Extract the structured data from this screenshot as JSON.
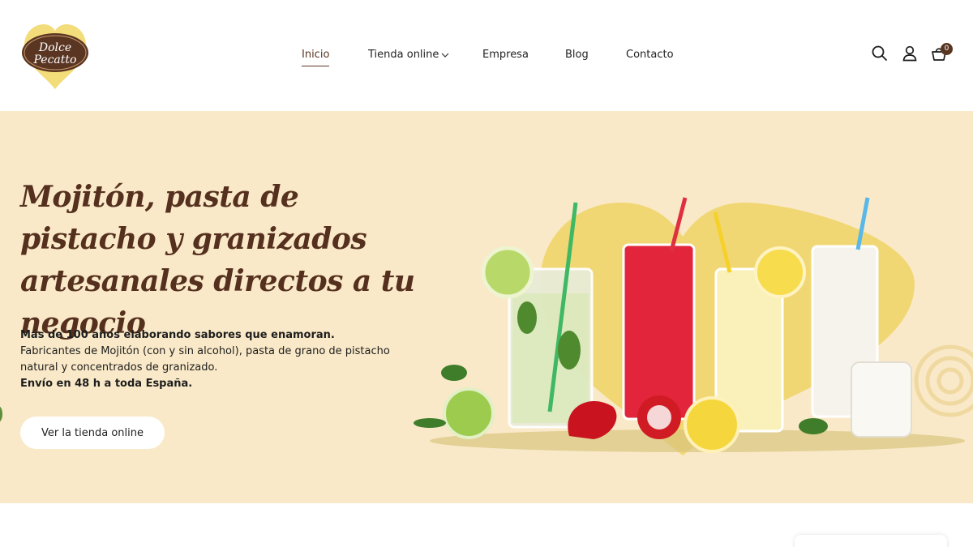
{
  "header": {
    "logo_alt": "Dolce Pecatto",
    "nav": [
      {
        "label": "Inicio",
        "active": true
      },
      {
        "label": "Tienda online",
        "has_dropdown": true
      },
      {
        "label": "Empresa"
      },
      {
        "label": "Blog"
      },
      {
        "label": "Contacto"
      }
    ],
    "icons": [
      "search-icon",
      "user-icon",
      "cart-icon"
    ],
    "cart_count": "0"
  },
  "hero": {
    "title": "Mojitón, pasta de pistacho y granizados artesanales directos a tu negocio",
    "line1": "Más de 100 años elaborando sabores que enamoran.",
    "line2": "Fabricantes de Mojitón (con y sin alcohol), pasta de grano de pistacho natural y concentrados de granizado.",
    "line3": "Envío en 48 h a toda España.",
    "cta_label": "Ver la tienda online"
  },
  "colors": {
    "brand_brown": "#5a3522",
    "hero_bg": "#f9e9c8",
    "logo_yellow": "#f3dc7a"
  }
}
